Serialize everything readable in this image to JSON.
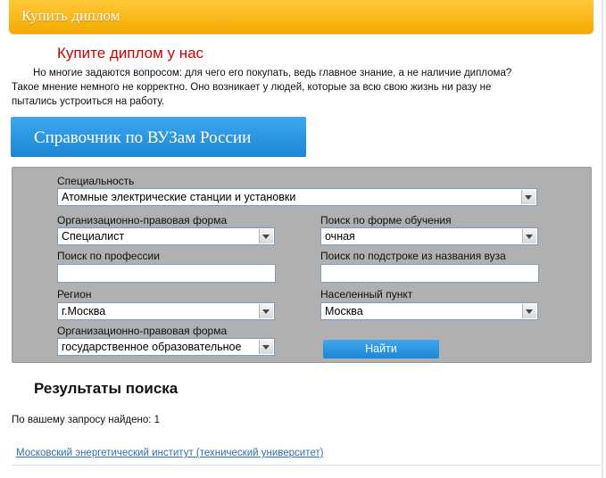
{
  "header": {
    "title": "Купить диплом"
  },
  "article": {
    "headline": "Купите диплом у нас",
    "paragraph_line1": "Но многие задаются вопросом: для чего его покупать, ведь главное знание, а не наличие диплома?",
    "paragraph_line2": "Такое мнение немного не корректно. Оно возникает у людей, которые за всю свою жизнь ни разу не",
    "paragraph_line3": "пытались устроиться на работу."
  },
  "banner": {
    "label": "Справочник по ВУЗам России"
  },
  "search_form": {
    "specialty": {
      "label": "Специальность",
      "value": "Атомные электрические станции и установки"
    },
    "org_form_1": {
      "label": "Организационно-правовая форма",
      "value": "Специалист"
    },
    "study_form": {
      "label": "Поиск по форме обучения",
      "value": "очная"
    },
    "profession": {
      "label": "Поиск по профессии",
      "value": ""
    },
    "name_substring": {
      "label": "Поиск по подстроке из названия вуза",
      "value": ""
    },
    "region": {
      "label": "Регион",
      "value": "г.Москва"
    },
    "locality": {
      "label": "Населенный пункт",
      "value": "Москва"
    },
    "org_form_2": {
      "label": "Организационно-правовая форма",
      "value": "государственное образовательное"
    },
    "submit_label": "Найти"
  },
  "results": {
    "title": "Результаты поиска",
    "count_text": "По вашему запросу найдено: 1",
    "items": [
      "Московский энергетический институт (технический университет)"
    ]
  },
  "colors": {
    "header_bg": "#f4a900",
    "headline": "#d40000",
    "accent_blue": "#1d86d6",
    "panel_bg": "#b0b0b0",
    "link": "#2f6fb0"
  }
}
